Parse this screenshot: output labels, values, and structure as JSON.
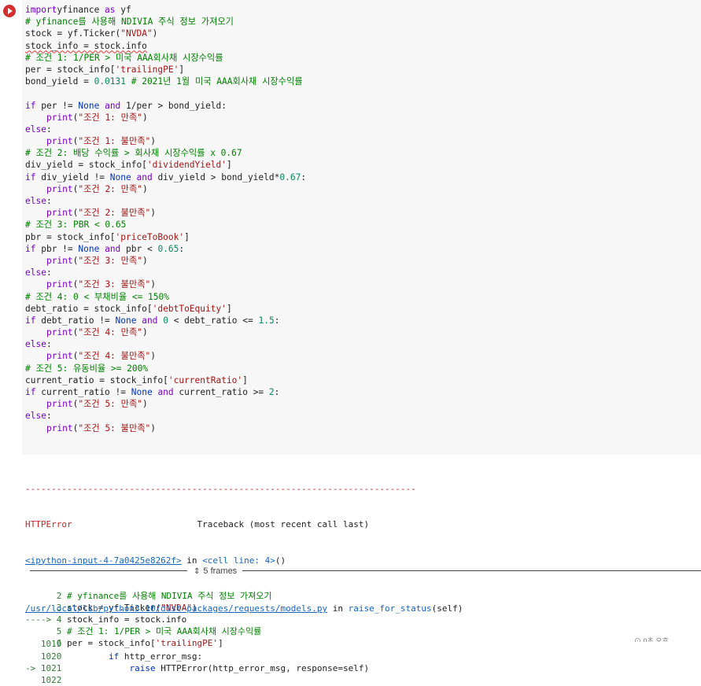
{
  "code_lines": [
    [
      [
        "kw",
        "import"
      ],
      [
        "",
        "yfinance "
      ],
      [
        "kw",
        "as"
      ],
      [
        "",
        " yf"
      ]
    ],
    [
      [
        "cm",
        "# yfinance를 사용해 NDIVIA 주식 정보 가져오기"
      ]
    ],
    [
      [
        "",
        "stock = yf.Ticker("
      ],
      [
        "st",
        "\"NVDA\""
      ],
      [
        "",
        ")"
      ]
    ],
    [
      [
        "squig",
        "stock_info = stock.info"
      ]
    ],
    [
      [
        "cm",
        "# 조건 1: 1/PER > 미국 AAA회사채 시장수익률"
      ]
    ],
    [
      [
        "",
        "per = stock_info["
      ],
      [
        "st",
        "'trailingPE'"
      ],
      [
        "",
        "]"
      ]
    ],
    [
      [
        "",
        "bond_yield = "
      ],
      [
        "nm",
        "0.0131"
      ],
      [
        "",
        " "
      ],
      [
        "cm",
        "# 2021년 1월 미국 AAA회사채 시장수익률"
      ]
    ],
    [
      [
        "",
        ""
      ]
    ],
    [
      [
        "kw",
        "if"
      ],
      [
        "",
        " per != "
      ],
      [
        "kw2",
        "None"
      ],
      [
        "",
        " "
      ],
      [
        "kw",
        "and"
      ],
      [
        "",
        " 1/per > bond_yield:"
      ]
    ],
    [
      [
        "",
        "    "
      ],
      [
        "kw",
        "print"
      ],
      [
        "",
        "("
      ],
      [
        "st",
        "\"조건 1: 만족\""
      ],
      [
        "",
        ")"
      ]
    ],
    [
      [
        "kw",
        "else"
      ],
      [
        "",
        ":"
      ]
    ],
    [
      [
        "",
        "    "
      ],
      [
        "kw",
        "print"
      ],
      [
        "",
        "("
      ],
      [
        "st",
        "\"조건 1: 불만족\""
      ],
      [
        "",
        ")"
      ]
    ],
    [
      [
        "cm",
        "# 조건 2: 배당 수익률 > 회사채 시장수익률 x 0.67"
      ]
    ],
    [
      [
        "",
        "div_yield = stock_info["
      ],
      [
        "st",
        "'dividendYield'"
      ],
      [
        "",
        "]"
      ]
    ],
    [
      [
        "kw",
        "if"
      ],
      [
        "",
        " div_yield != "
      ],
      [
        "kw2",
        "None"
      ],
      [
        "",
        " "
      ],
      [
        "kw",
        "and"
      ],
      [
        "",
        " div_yield > bond_yield*"
      ],
      [
        "nm",
        "0.67"
      ],
      [
        "",
        ":"
      ]
    ],
    [
      [
        "",
        "    "
      ],
      [
        "kw",
        "print"
      ],
      [
        "",
        "("
      ],
      [
        "st",
        "\"조건 2: 만족\""
      ],
      [
        "",
        ")"
      ]
    ],
    [
      [
        "kw",
        "else"
      ],
      [
        "",
        ":"
      ]
    ],
    [
      [
        "",
        "    "
      ],
      [
        "kw",
        "print"
      ],
      [
        "",
        "("
      ],
      [
        "st",
        "\"조건 2: 불만족\""
      ],
      [
        "",
        ")"
      ]
    ],
    [
      [
        "cm",
        "# 조건 3: PBR < 0.65"
      ]
    ],
    [
      [
        "",
        "pbr = stock_info["
      ],
      [
        "st",
        "'priceToBook'"
      ],
      [
        "",
        "]"
      ]
    ],
    [
      [
        "kw",
        "if"
      ],
      [
        "",
        " pbr != "
      ],
      [
        "kw2",
        "None"
      ],
      [
        "",
        " "
      ],
      [
        "kw",
        "and"
      ],
      [
        "",
        " pbr < "
      ],
      [
        "nm",
        "0.65"
      ],
      [
        "",
        ":"
      ]
    ],
    [
      [
        "",
        "    "
      ],
      [
        "kw",
        "print"
      ],
      [
        "",
        "("
      ],
      [
        "st",
        "\"조건 3: 만족\""
      ],
      [
        "",
        ")"
      ]
    ],
    [
      [
        "kw",
        "else"
      ],
      [
        "",
        ":"
      ]
    ],
    [
      [
        "",
        "    "
      ],
      [
        "kw",
        "print"
      ],
      [
        "",
        "("
      ],
      [
        "st",
        "\"조건 3: 불만족\""
      ],
      [
        "",
        ")"
      ]
    ],
    [
      [
        "cm",
        "# 조건 4: 0 < 부채비율 <= 150%"
      ]
    ],
    [
      [
        "",
        "debt_ratio = stock_info["
      ],
      [
        "st",
        "'debtToEquity'"
      ],
      [
        "",
        "]"
      ]
    ],
    [
      [
        "kw",
        "if"
      ],
      [
        "",
        " debt_ratio != "
      ],
      [
        "kw2",
        "None"
      ],
      [
        "",
        " "
      ],
      [
        "kw",
        "and"
      ],
      [
        "",
        " "
      ],
      [
        "nm",
        "0"
      ],
      [
        "",
        " < debt_ratio <= "
      ],
      [
        "nm",
        "1.5"
      ],
      [
        "",
        ":"
      ]
    ],
    [
      [
        "",
        "    "
      ],
      [
        "kw",
        "print"
      ],
      [
        "",
        "("
      ],
      [
        "st",
        "\"조건 4: 만족\""
      ],
      [
        "",
        ")"
      ]
    ],
    [
      [
        "kw",
        "else"
      ],
      [
        "",
        ":"
      ]
    ],
    [
      [
        "",
        "    "
      ],
      [
        "kw",
        "print"
      ],
      [
        "",
        "("
      ],
      [
        "st",
        "\"조건 4: 불만족\""
      ],
      [
        "",
        ")"
      ]
    ],
    [
      [
        "cm",
        "# 조건 5: 유동비율 >= 200%"
      ]
    ],
    [
      [
        "",
        "current_ratio = stock_info["
      ],
      [
        "st",
        "'currentRatio'"
      ],
      [
        "",
        "]"
      ]
    ],
    [
      [
        "kw",
        "if"
      ],
      [
        "",
        " current_ratio != "
      ],
      [
        "kw2",
        "None"
      ],
      [
        "",
        " "
      ],
      [
        "kw",
        "and"
      ],
      [
        "",
        " current_ratio >= "
      ],
      [
        "nm",
        "2"
      ],
      [
        "",
        ":"
      ]
    ],
    [
      [
        "",
        "    "
      ],
      [
        "kw",
        "print"
      ],
      [
        "",
        "("
      ],
      [
        "st",
        "\"조건 5: 만족\""
      ],
      [
        "",
        ")"
      ]
    ],
    [
      [
        "kw",
        "else"
      ],
      [
        "",
        ":"
      ]
    ],
    [
      [
        "",
        "    "
      ],
      [
        "kw",
        "print"
      ],
      [
        "",
        "("
      ],
      [
        "st",
        "\"조건 5: 불만족\""
      ],
      [
        "",
        ")"
      ]
    ]
  ],
  "output": {
    "separator": "---------------------------------------------------------------------------",
    "error_name": "HTTPError",
    "traceback_label": "                        Traceback (most recent call last)",
    "input_link": "<ipython-input-4-7a0425e8262f>",
    "in_text": " in ",
    "cell_line": "<cell line: 4>",
    "cell_line_suffix": "()",
    "tb_lines": [
      [
        [
          "lnum",
          "      2 "
        ],
        [
          "cm",
          "# yfinance를 사용해 NDIVIA 주식 정보 가져오기"
        ]
      ],
      [
        [
          "lnum",
          "      3 "
        ],
        [
          "",
          "stock = yf.Ticker("
        ],
        [
          "st",
          "\"NVDA\""
        ],
        [
          "",
          ")"
        ]
      ],
      [
        [
          "lnum",
          "----> 4 "
        ],
        [
          "",
          "stock_info = stock.info"
        ]
      ],
      [
        [
          "lnum",
          "      5 "
        ],
        [
          "cm",
          "# 조건 1: 1/PER > 미국 AAA회사채 시장수익률"
        ]
      ],
      [
        [
          "lnum",
          "      6 "
        ],
        [
          "",
          "per = stock_info["
        ],
        [
          "st",
          "'trailingPE'"
        ],
        [
          "",
          "]"
        ]
      ]
    ],
    "frames_label": "5 frames",
    "file_link": "/usr/local/lib/python3.10/dist-packages/requests/models.py",
    "file_in": " in ",
    "func": "raise_for_status",
    "func_args": "(self)",
    "file_lines": [
      [
        [
          "lnum",
          "   1019"
        ]
      ],
      [
        [
          "lnum",
          "   1020"
        ],
        [
          "",
          "         "
        ],
        [
          "kw2",
          "if"
        ],
        [
          "",
          " http_error_msg:"
        ]
      ],
      [
        [
          "lnum",
          "-> 1021"
        ],
        [
          "",
          "             "
        ],
        [
          "kw2",
          "raise"
        ],
        [
          "",
          " HTTPError(http_error_msg, response=self)"
        ]
      ],
      [
        [
          "lnum",
          "   1022"
        ]
      ]
    ]
  },
  "status": "⊙ 0초  오후"
}
